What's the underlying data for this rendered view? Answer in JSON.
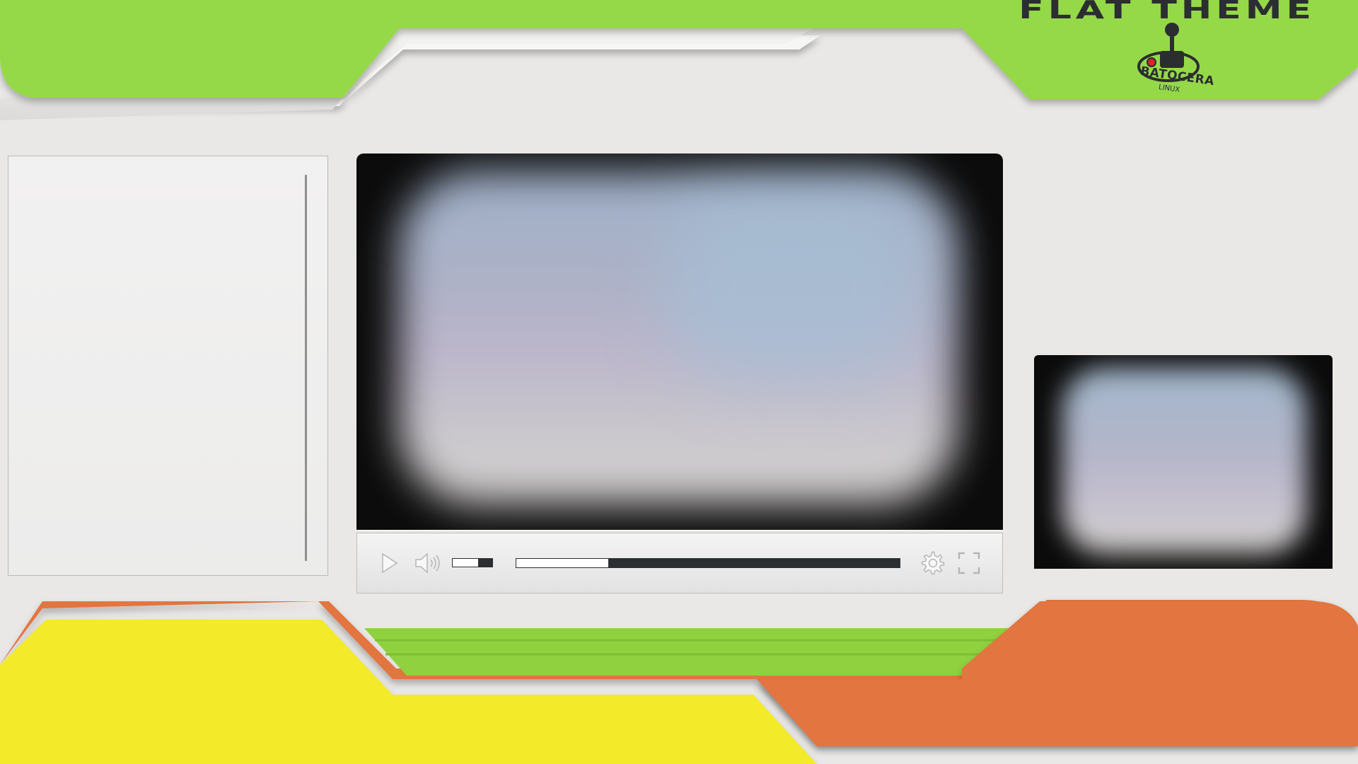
{
  "theme": {
    "title": "FLAT THEME",
    "logo_name": "BATOCERA",
    "logo_sub": "LINUX"
  },
  "colors": {
    "green": "#95d948",
    "orange": "#e27540",
    "yellow": "#f3ea2a",
    "panel_bg": "#e9e8e6",
    "dark": "#2b2e31"
  },
  "game_list": {
    "items": []
  },
  "player": {
    "volume_level": 0.65,
    "progress": 0.24,
    "icons": [
      "play-icon",
      "volume-icon",
      "settings-gear-icon",
      "fullscreen-icon"
    ]
  }
}
